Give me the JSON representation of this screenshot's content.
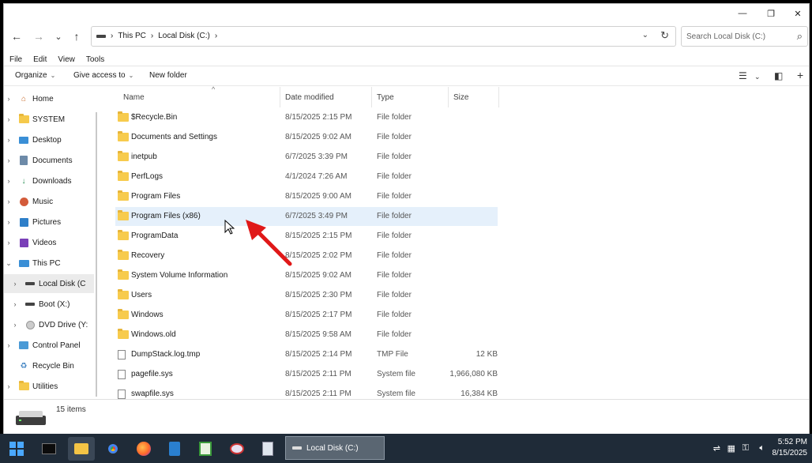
{
  "window": {
    "minimize": "—",
    "restore": "❐",
    "close": "✕"
  },
  "nav": {
    "back": "←",
    "forward": "→",
    "recent": "⌄",
    "up": "↑"
  },
  "address": {
    "crumbs": [
      "This PC",
      "Local Disk (C:)"
    ],
    "separator": "›"
  },
  "search": {
    "placeholder": "Search Local Disk (C:)"
  },
  "menu": [
    "File",
    "Edit",
    "View",
    "Tools"
  ],
  "commands": {
    "organize": "Organize",
    "give_access": "Give access to",
    "new_folder": "New folder"
  },
  "sidebar": {
    "items": [
      {
        "label": "Home",
        "icon": "home-icon"
      },
      {
        "label": "SYSTEM",
        "icon": "folder-icon"
      },
      {
        "label": "Desktop",
        "icon": "desktop-icon"
      },
      {
        "label": "Documents",
        "icon": "documents-icon"
      },
      {
        "label": "Downloads",
        "icon": "downloads-icon"
      },
      {
        "label": "Music",
        "icon": "music-icon"
      },
      {
        "label": "Pictures",
        "icon": "pictures-icon"
      },
      {
        "label": "Videos",
        "icon": "videos-icon"
      },
      {
        "label": "This PC",
        "icon": "pc-icon"
      },
      {
        "label": "Local Disk (C",
        "icon": "drive-icon"
      },
      {
        "label": "Boot (X:)",
        "icon": "drive-icon"
      },
      {
        "label": "DVD Drive (Y:",
        "icon": "dvd-icon"
      },
      {
        "label": "Control Panel",
        "icon": "control-panel-icon"
      },
      {
        "label": "Recycle Bin",
        "icon": "recycle-bin-icon"
      },
      {
        "label": "Utilities",
        "icon": "folder-icon"
      }
    ]
  },
  "columns": {
    "name": "Name",
    "date": "Date modified",
    "type": "Type",
    "size": "Size"
  },
  "files": [
    {
      "name": "$Recycle.Bin",
      "date": "8/15/2025 2:15 PM",
      "type": "File folder",
      "size": "",
      "kind": "folder"
    },
    {
      "name": "Documents and Settings",
      "date": "8/15/2025 9:02 AM",
      "type": "File folder",
      "size": "",
      "kind": "folder"
    },
    {
      "name": "inetpub",
      "date": "6/7/2025 3:39 PM",
      "type": "File folder",
      "size": "",
      "kind": "folder"
    },
    {
      "name": "PerfLogs",
      "date": "4/1/2024 7:26 AM",
      "type": "File folder",
      "size": "",
      "kind": "folder"
    },
    {
      "name": "Program Files",
      "date": "8/15/2025 9:00 AM",
      "type": "File folder",
      "size": "",
      "kind": "folder"
    },
    {
      "name": "Program Files (x86)",
      "date": "6/7/2025 3:49 PM",
      "type": "File folder",
      "size": "",
      "kind": "folder"
    },
    {
      "name": "ProgramData",
      "date": "8/15/2025 2:15 PM",
      "type": "File folder",
      "size": "",
      "kind": "folder"
    },
    {
      "name": "Recovery",
      "date": "8/15/2025 2:02 PM",
      "type": "File folder",
      "size": "",
      "kind": "folder"
    },
    {
      "name": "System Volume Information",
      "date": "8/15/2025 9:02 AM",
      "type": "File folder",
      "size": "",
      "kind": "folder"
    },
    {
      "name": "Users",
      "date": "8/15/2025 2:30 PM",
      "type": "File folder",
      "size": "",
      "kind": "folder"
    },
    {
      "name": "Windows",
      "date": "8/15/2025 2:17 PM",
      "type": "File folder",
      "size": "",
      "kind": "folder"
    },
    {
      "name": "Windows.old",
      "date": "8/15/2025 9:58 AM",
      "type": "File folder",
      "size": "",
      "kind": "folder"
    },
    {
      "name": "DumpStack.log.tmp",
      "date": "8/15/2025 2:14 PM",
      "type": "TMP File",
      "size": "12 KB",
      "kind": "file"
    },
    {
      "name": "pagefile.sys",
      "date": "8/15/2025 2:11 PM",
      "type": "System file",
      "size": "1,966,080 KB",
      "kind": "file"
    },
    {
      "name": "swapfile.sys",
      "date": "8/15/2025 2:11 PM",
      "type": "System file",
      "size": "16,384 KB",
      "kind": "file"
    }
  ],
  "status": {
    "count": "15 items"
  },
  "taskbar": {
    "active_window": "Local Disk (C:)",
    "time": "5:52 PM",
    "date": "8/15/2025"
  },
  "colors": {
    "highlight_row": "#e5f0fb",
    "arrow": "#e01818",
    "taskbar": "#1f2b38"
  }
}
